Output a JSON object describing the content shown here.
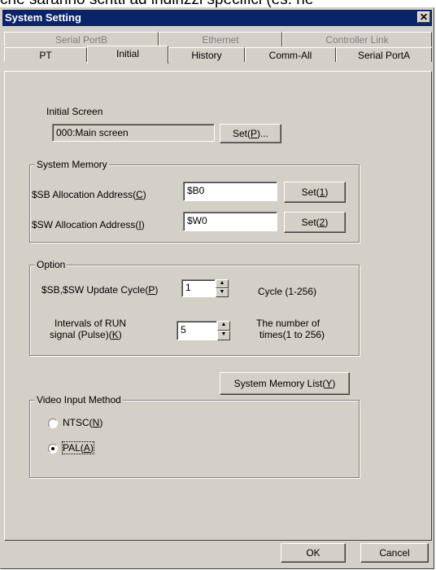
{
  "background_text": "che saranno scritti ad indirizzi specifici (es. ne",
  "window": {
    "title": "System Setting",
    "close_glyph": "✕"
  },
  "tabs": {
    "row1": [
      "Serial PortB",
      "Ethernet",
      "Controller Link"
    ],
    "row2": [
      "PT",
      "Initial",
      "History",
      "Comm-All",
      "Serial PortA"
    ],
    "active": "Initial"
  },
  "initial_screen": {
    "label": "Initial Screen",
    "value": "000:Main screen",
    "set_button": {
      "prefix": "Set(",
      "key": "P",
      "suffix": ")..."
    }
  },
  "system_memory": {
    "title": "System Memory",
    "sb": {
      "label_prefix": "$SB Allocation Address(",
      "key": "C",
      "label_suffix": ")",
      "value": "$B0",
      "button": {
        "prefix": "Set(",
        "key": "1",
        "suffix": ")"
      }
    },
    "sw": {
      "label_prefix": "$SW Allocation Address(",
      "key": "I",
      "label_suffix": ")",
      "value": "$W0",
      "button": {
        "prefix": "Set(",
        "key": "2",
        "suffix": ")"
      }
    }
  },
  "option": {
    "title": "Option",
    "update_cycle": {
      "label_prefix": "$SB,$SW Update Cycle(",
      "key": "P",
      "label_suffix": ")",
      "value": "1",
      "hint": "Cycle (1-256)"
    },
    "run_interval": {
      "label_line1": "Intervals of RUN",
      "label_line2_prefix": "signal (Pulse)(",
      "key": "K",
      "label_line2_suffix": ")",
      "value": "5",
      "hint_line1": "The number of",
      "hint_line2": "times(1 to 256)"
    }
  },
  "system_memory_list_button": {
    "prefix": "System Memory List(",
    "key": "Y",
    "suffix": ")"
  },
  "video_input": {
    "title": "Video Input Method",
    "options": [
      {
        "prefix": "NTSC(",
        "key": "N",
        "suffix": ")",
        "checked": false
      },
      {
        "prefix": "PAL(",
        "key": "A",
        "suffix": ")",
        "checked": true
      }
    ]
  },
  "footer": {
    "ok": "OK",
    "cancel": "Cancel"
  }
}
